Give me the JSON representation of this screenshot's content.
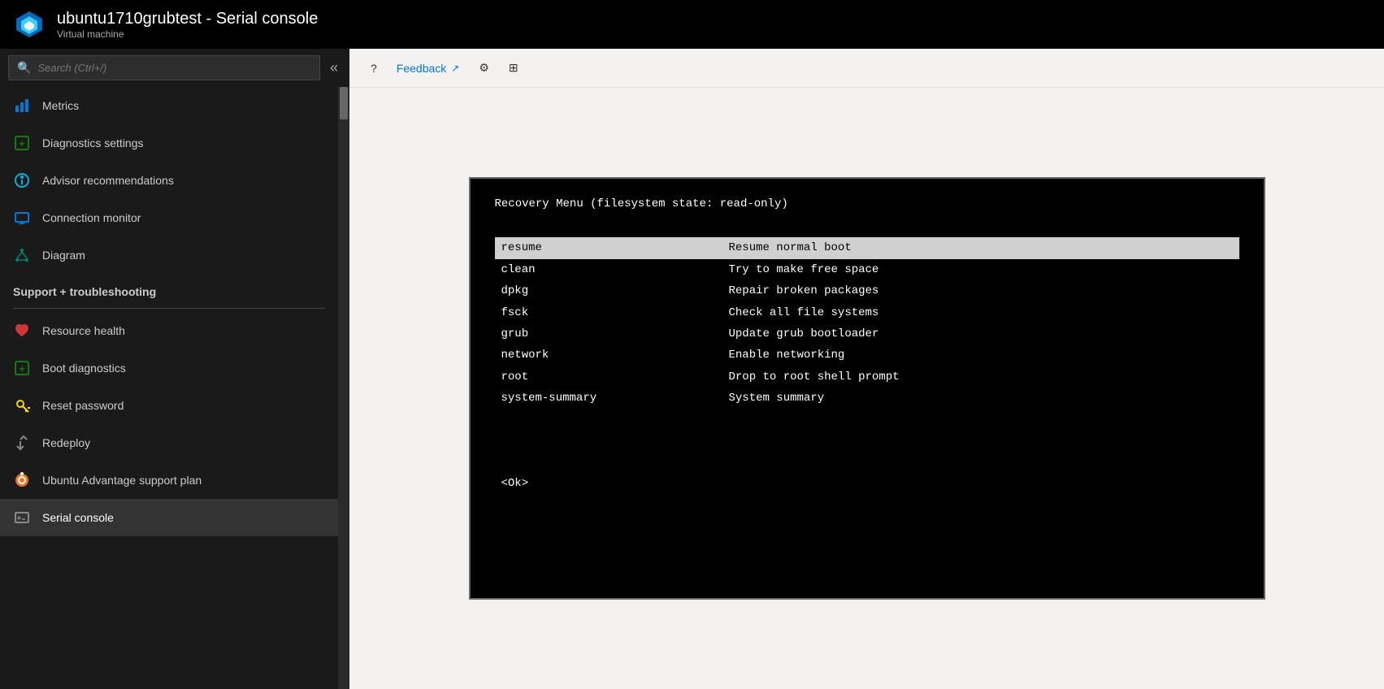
{
  "header": {
    "title": "ubuntu1710grubtest - Serial console",
    "subtitle": "Virtual machine"
  },
  "search": {
    "placeholder": "Search (Ctrl+/)"
  },
  "sidebar": {
    "items": [
      {
        "id": "metrics",
        "label": "Metrics",
        "icon": "bar-chart-icon",
        "iconColor": "blue"
      },
      {
        "id": "diagnostics-settings",
        "label": "Diagnostics settings",
        "icon": "diagnostics-icon",
        "iconColor": "green"
      },
      {
        "id": "advisor-recommendations",
        "label": "Advisor recommendations",
        "icon": "advisor-icon",
        "iconColor": "cyan"
      },
      {
        "id": "connection-monitor",
        "label": "Connection monitor",
        "icon": "monitor-icon",
        "iconColor": "blue"
      },
      {
        "id": "diagram",
        "label": "Diagram",
        "icon": "diagram-icon",
        "iconColor": "teal"
      }
    ],
    "sectionHeader": "Support + troubleshooting",
    "supportItems": [
      {
        "id": "resource-health",
        "label": "Resource health",
        "icon": "heart-icon",
        "iconColor": "red"
      },
      {
        "id": "boot-diagnostics",
        "label": "Boot diagnostics",
        "icon": "boot-icon",
        "iconColor": "green"
      },
      {
        "id": "reset-password",
        "label": "Reset password",
        "icon": "key-icon",
        "iconColor": "yellow"
      },
      {
        "id": "redeploy",
        "label": "Redeploy",
        "icon": "redeploy-icon",
        "iconColor": "gray"
      },
      {
        "id": "ubuntu-advantage",
        "label": "Ubuntu Advantage support plan",
        "icon": "ubuntu-icon",
        "iconColor": "orange"
      },
      {
        "id": "serial-console",
        "label": "Serial console",
        "icon": "console-icon",
        "iconColor": "gray",
        "active": true
      }
    ]
  },
  "toolbar": {
    "help_label": "?",
    "feedback_label": "Feedback",
    "settings_label": "⚙",
    "grid_label": "⊞"
  },
  "terminal": {
    "title": "Recovery Menu (filesystem state: read-only)",
    "selected_key": "resume",
    "selected_desc": "Resume normal boot",
    "menu_items": [
      {
        "key": "clean",
        "desc": "Try to make free space"
      },
      {
        "key": "dpkg",
        "desc": "Repair broken packages"
      },
      {
        "key": "fsck",
        "desc": "Check all file systems"
      },
      {
        "key": "grub",
        "desc": "Update grub bootloader"
      },
      {
        "key": "network",
        "desc": "Enable networking"
      },
      {
        "key": "root",
        "desc": "Drop to root shell prompt"
      },
      {
        "key": "system-summary",
        "desc": "System summary"
      }
    ],
    "ok_label": "<Ok>"
  }
}
